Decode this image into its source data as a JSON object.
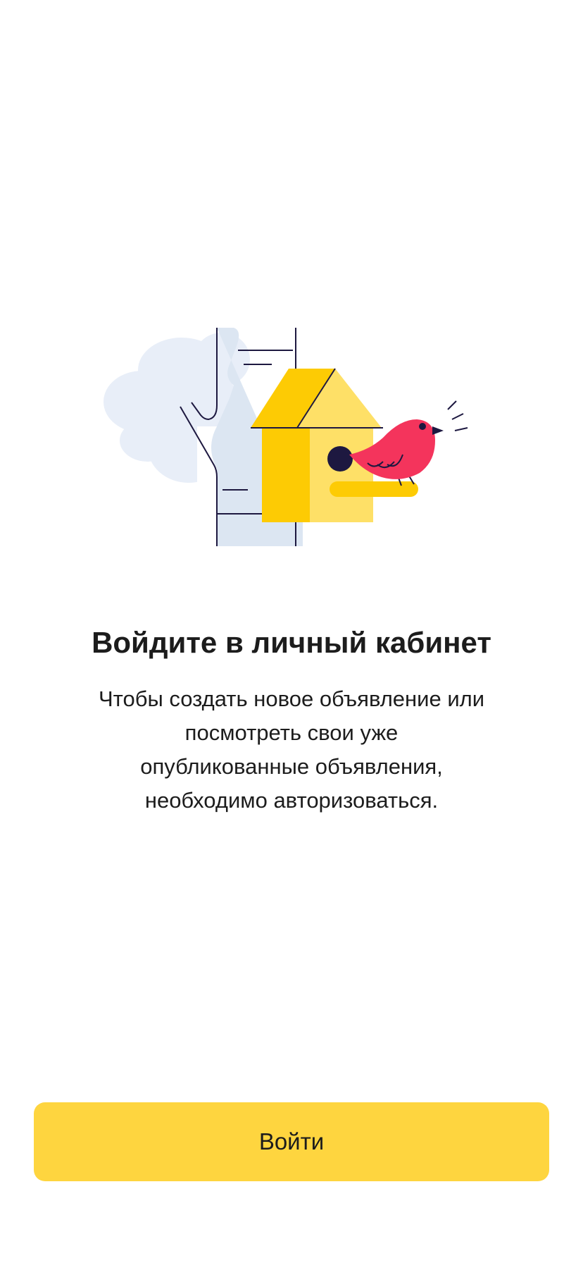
{
  "illustration": {
    "icon": "birdhouse-with-bird-illustration",
    "colors": {
      "cloud": "#e8eef8",
      "trunk_fill": "#dce6f2",
      "outline": "#1d1840",
      "roof_dark": "#fdcb04",
      "roof_light": "#fee067",
      "house_dark": "#fdcb04",
      "house_light": "#fee067",
      "bird": "#f4345c"
    }
  },
  "screen": {
    "title": "Войдите в личный кабинет",
    "description_lines": [
      "Чтобы создать новое объявление или",
      "посмотреть свои уже",
      "опубликованные объявления,",
      "необходимо авторизоваться."
    ]
  },
  "actions": {
    "login_label": "Войти",
    "login_color": "#fed53f"
  }
}
